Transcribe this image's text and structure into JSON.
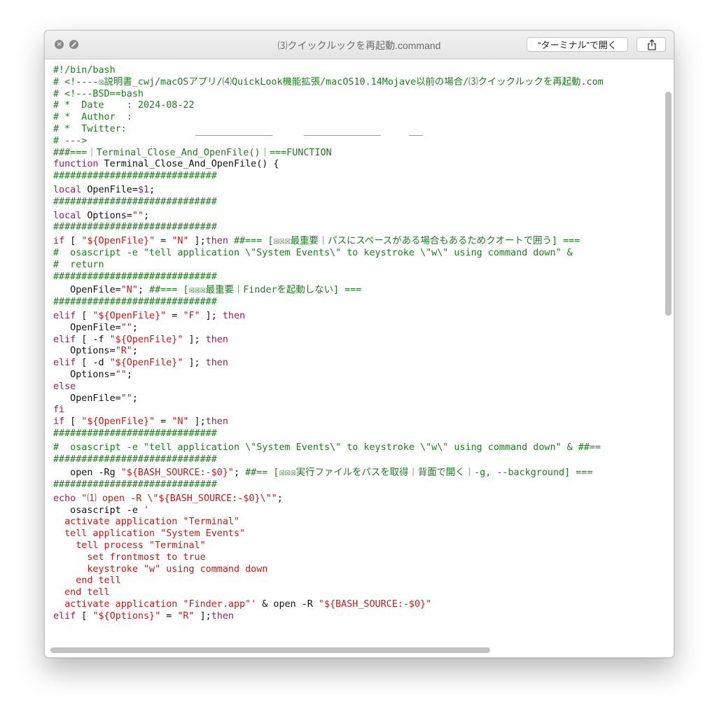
{
  "window": {
    "title": "⑶クイックルックを再起動.command",
    "open_button_label": "“ターミナル”で開く",
    "close_icon": "x-circle-icon",
    "fullscreen_icon": "slash-circle-icon",
    "share_icon": "share-icon"
  },
  "colors": {
    "comment": "#1a7f1a",
    "keyword": "#a0195d",
    "string": "#c41a16",
    "variable": "#8b1a8b",
    "plain": "#111111"
  },
  "code_lines": [
    [
      [
        "c",
        "#!/bin/bash"
      ]
    ],
    [
      [
        "c",
        "# <!----☒説明書_cwj/macOSアプリ/⑷QuickLook機能拡張/macOS10.14Mojave以前の場合/⑶クイックルックを再起動.com"
      ]
    ],
    [
      [
        "c",
        "# <!---BSD==bash"
      ]
    ],
    [
      [
        "c",
        "# *  Date    : 2024-08-22"
      ]
    ],
    [
      [
        "c",
        "# *  Author  :"
      ]
    ],
    [
      [
        "c",
        "# *  Twitter:"
      ]
    ],
    [
      [
        "c",
        "# --->"
      ]
    ],
    [
      [
        "c",
        "###===｜Terminal_Close_And_OpenFile()｜===FUNCTION"
      ]
    ],
    [
      [
        "k",
        "function"
      ],
      [
        "p",
        " Terminal_Close_And_OpenFile() {"
      ]
    ],
    [
      [
        "c",
        "#############################"
      ]
    ],
    [
      [
        "k",
        "local"
      ],
      [
        "p",
        " OpenFile="
      ],
      [
        "v",
        "$1"
      ],
      [
        "p",
        ";"
      ]
    ],
    [
      [
        "c",
        "#############################"
      ]
    ],
    [
      [
        "k",
        "local"
      ],
      [
        "p",
        " Options="
      ],
      [
        "s",
        "\"\""
      ],
      [
        "p",
        ";"
      ]
    ],
    [
      [
        "c",
        "#############################"
      ]
    ],
    [
      [
        "k",
        "if"
      ],
      [
        "p",
        " [ "
      ],
      [
        "s",
        "\"${OpenFile}\""
      ],
      [
        "p",
        " = "
      ],
      [
        "s",
        "\"N\""
      ],
      [
        "p",
        " ];"
      ],
      [
        "k",
        "then"
      ],
      [
        "c",
        " ##=== [☒☒☒最重要｜パスにスペースがある場合もあるためクオートで囲う] ==="
      ]
    ],
    [
      [
        "c",
        "#  osascript -e \"tell application \\\"System Events\\\" to keystroke \\\"w\\\" using command down\" &"
      ]
    ],
    [
      [
        "c",
        "#  return"
      ]
    ],
    [
      [
        "c",
        "#############################"
      ]
    ],
    [
      [
        "p",
        "   OpenFile="
      ],
      [
        "s",
        "\"N\""
      ],
      [
        "p",
        "; "
      ],
      [
        "c",
        "##=== [☒☒☒最重要｜Finderを起動しない] ==="
      ]
    ],
    [
      [
        "c",
        "#############################"
      ]
    ],
    [
      [
        "k",
        "elif"
      ],
      [
        "p",
        " [ "
      ],
      [
        "s",
        "\"${OpenFile}\""
      ],
      [
        "p",
        " = "
      ],
      [
        "s",
        "\"F\""
      ],
      [
        "p",
        " ]; "
      ],
      [
        "k",
        "then"
      ]
    ],
    [
      [
        "p",
        "   OpenFile="
      ],
      [
        "s",
        "\"\""
      ],
      [
        "p",
        ";"
      ]
    ],
    [
      [
        "k",
        "elif"
      ],
      [
        "p",
        " [ -f "
      ],
      [
        "s",
        "\"${OpenFile}\""
      ],
      [
        "p",
        " ]; "
      ],
      [
        "k",
        "then"
      ]
    ],
    [
      [
        "p",
        "   Options="
      ],
      [
        "s",
        "\"R\""
      ],
      [
        "p",
        ";"
      ]
    ],
    [
      [
        "k",
        "elif"
      ],
      [
        "p",
        " [ -d "
      ],
      [
        "s",
        "\"${OpenFile}\""
      ],
      [
        "p",
        " ]; "
      ],
      [
        "k",
        "then"
      ]
    ],
    [
      [
        "p",
        "   Options="
      ],
      [
        "s",
        "\"\""
      ],
      [
        "p",
        ";"
      ]
    ],
    [
      [
        "k",
        "else"
      ]
    ],
    [
      [
        "p",
        "   OpenFile="
      ],
      [
        "s",
        "\"\""
      ],
      [
        "p",
        ";"
      ]
    ],
    [
      [
        "k",
        "fi"
      ]
    ],
    [
      [
        "k",
        "if"
      ],
      [
        "p",
        " [ "
      ],
      [
        "s",
        "\"${OpenFile}\""
      ],
      [
        "p",
        " = "
      ],
      [
        "s",
        "\"N\""
      ],
      [
        "p",
        " ];"
      ],
      [
        "k",
        "then"
      ]
    ],
    [
      [
        "c",
        "#############################"
      ]
    ],
    [
      [
        "c",
        "#  osascript -e \"tell application \\\"System Events\\\" to keystroke \\\"w\\\" using command down\" & ##=="
      ]
    ],
    [
      [
        "c",
        "#############################"
      ]
    ],
    [
      [
        "p",
        "   open -Rg "
      ],
      [
        "s",
        "\"${BASH_SOURCE:-$0}\""
      ],
      [
        "p",
        "; "
      ],
      [
        "c",
        "##== [☒☒☒実行ファイルをパスを取得｜背面で開く｜-g, --background] ==="
      ]
    ],
    [
      [
        "c",
        "#############################"
      ]
    ],
    [
      [
        "k",
        "echo"
      ],
      [
        "s",
        " \"⑴ open -R \\\"${BASH_SOURCE:-$0}\\\"\""
      ],
      [
        "p",
        ";"
      ]
    ],
    [
      [
        "p",
        "   osascript -e "
      ],
      [
        "s",
        "'"
      ]
    ],
    [
      [
        "s",
        "  activate application \"Terminal\""
      ]
    ],
    [
      [
        "s",
        "  tell application \"System Events\""
      ]
    ],
    [
      [
        "s",
        "    tell process \"Terminal\""
      ]
    ],
    [
      [
        "s",
        "      set frontmost to true"
      ]
    ],
    [
      [
        "s",
        "      keystroke \"w\" using command down"
      ]
    ],
    [
      [
        "s",
        "    end tell"
      ]
    ],
    [
      [
        "s",
        "  end tell"
      ]
    ],
    [
      [
        "s",
        "  activate application \"Finder.app\"'"
      ],
      [
        "p",
        " & open -R "
      ],
      [
        "s",
        "\"${BASH_SOURCE:-$0}\""
      ]
    ],
    [
      [
        "k",
        "elif"
      ],
      [
        "p",
        " [ "
      ],
      [
        "s",
        "\"${Options}\""
      ],
      [
        "p",
        " = "
      ],
      [
        "s",
        "\"R\""
      ],
      [
        "p",
        " ];"
      ],
      [
        "k",
        "then"
      ]
    ]
  ]
}
